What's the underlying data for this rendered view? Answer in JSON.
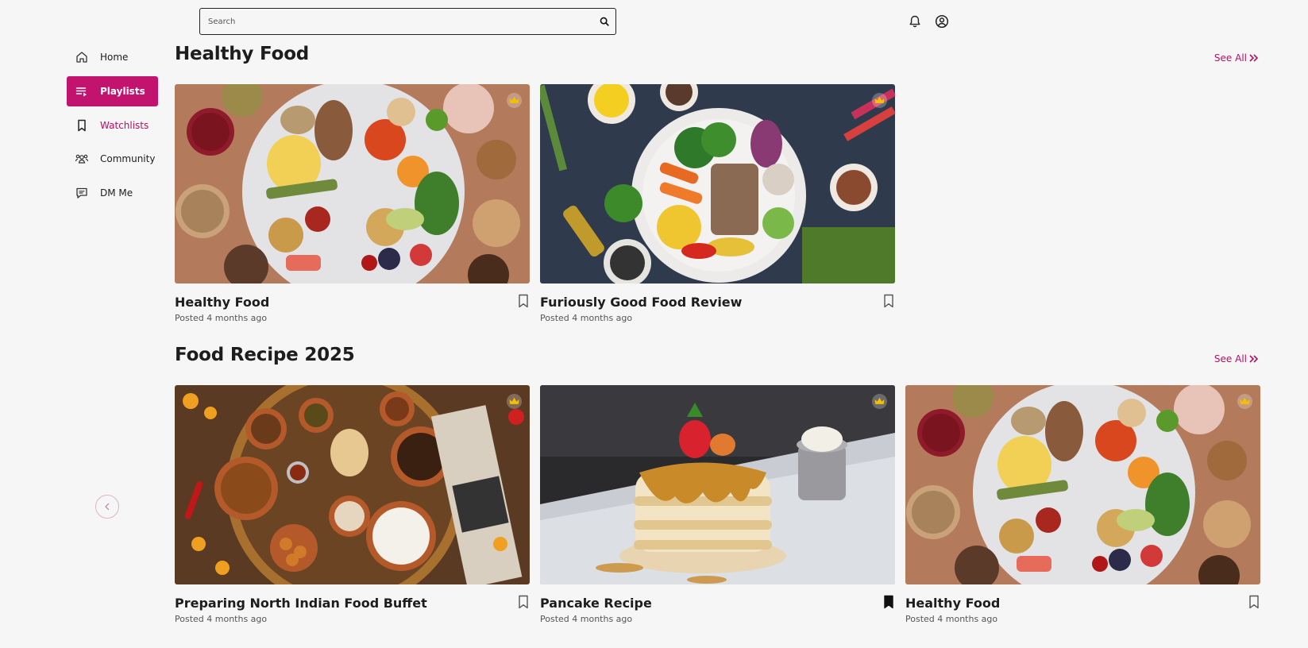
{
  "search": {
    "placeholder": "Search"
  },
  "topbar": {
    "notification_icon": "bell-icon",
    "profile_icon": "user-circle-icon"
  },
  "sidebar": {
    "items": [
      {
        "label": "Home",
        "icon": "home-icon",
        "state": "default"
      },
      {
        "label": "Playlists",
        "icon": "playlist-icon",
        "state": "active"
      },
      {
        "label": "Watchlists",
        "icon": "bookmark-icon",
        "state": "accent"
      },
      {
        "label": "Community",
        "icon": "community-icon",
        "state": "default"
      },
      {
        "label": "DM Me",
        "icon": "message-icon",
        "state": "default"
      }
    ],
    "collapse_icon": "chevron-left-icon"
  },
  "colors": {
    "accent": "#c2136f",
    "accent_text": "#b3125f",
    "background": "#f6f6f6",
    "crown": "#f2c200"
  },
  "sections": [
    {
      "title": "Healthy Food",
      "see_all": "See All",
      "cards": [
        {
          "title": "Healthy Food",
          "meta": "Posted 4 months ago",
          "premium": true,
          "bookmarked": false,
          "image": "healthy-plate"
        },
        {
          "title": "Furiously Good Food Review",
          "meta": "Posted 4 months ago",
          "premium": true,
          "bookmarked": false,
          "image": "salad-bowl"
        }
      ]
    },
    {
      "title": "Food Recipe 2025",
      "see_all": "See All",
      "cards": [
        {
          "title": "Preparing North Indian Food Buffet",
          "meta": "Posted 4 months ago",
          "premium": true,
          "bookmarked": false,
          "image": "indian-thali"
        },
        {
          "title": "Pancake Recipe",
          "meta": "Posted 4 months ago",
          "premium": true,
          "bookmarked": true,
          "image": "pancakes"
        },
        {
          "title": "Healthy Food",
          "meta": "Posted 4 months ago",
          "premium": true,
          "bookmarked": false,
          "image": "healthy-plate"
        }
      ]
    }
  ]
}
